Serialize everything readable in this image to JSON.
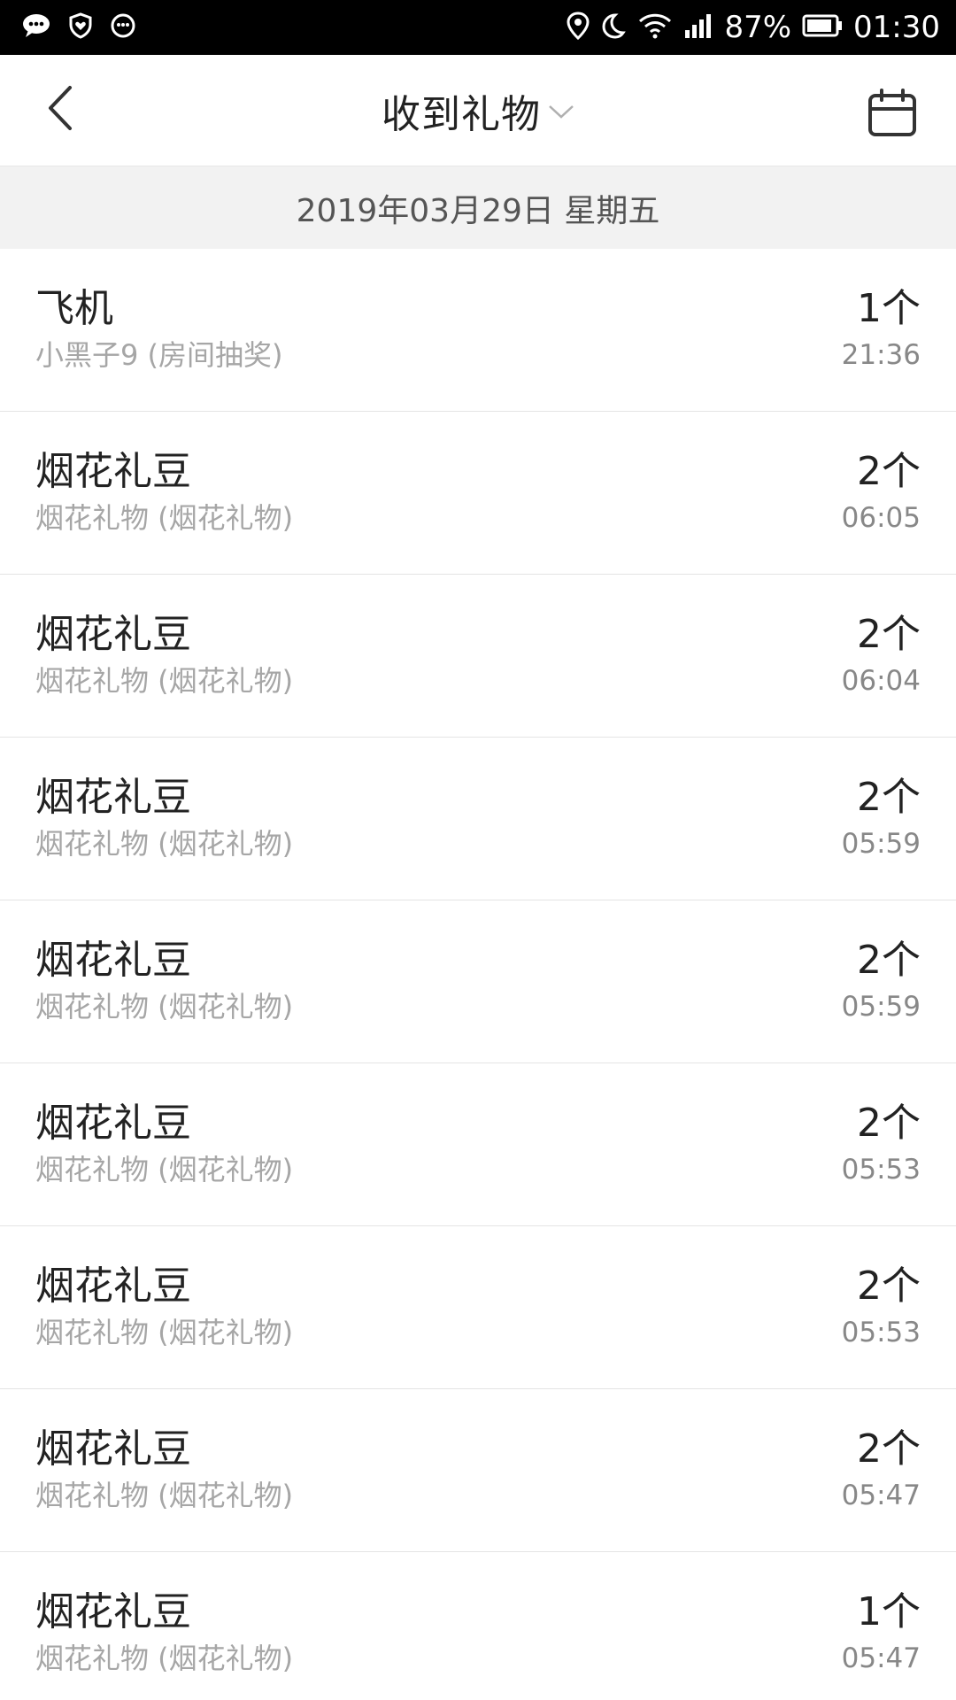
{
  "status_bar": {
    "battery": "87%",
    "time": "01:30"
  },
  "header": {
    "title": "收到礼物"
  },
  "date_bar": {
    "date": "2019年03月29日 星期五"
  },
  "gifts": [
    {
      "name": "飞机",
      "sender": "小黑子9 (房间抽奖)",
      "count": "1个",
      "time": "21:36"
    },
    {
      "name": "烟花礼豆",
      "sender": "烟花礼物 (烟花礼物)",
      "count": "2个",
      "time": "06:05"
    },
    {
      "name": "烟花礼豆",
      "sender": "烟花礼物 (烟花礼物)",
      "count": "2个",
      "time": "06:04"
    },
    {
      "name": "烟花礼豆",
      "sender": "烟花礼物 (烟花礼物)",
      "count": "2个",
      "time": "05:59"
    },
    {
      "name": "烟花礼豆",
      "sender": "烟花礼物 (烟花礼物)",
      "count": "2个",
      "time": "05:59"
    },
    {
      "name": "烟花礼豆",
      "sender": "烟花礼物 (烟花礼物)",
      "count": "2个",
      "time": "05:53"
    },
    {
      "name": "烟花礼豆",
      "sender": "烟花礼物 (烟花礼物)",
      "count": "2个",
      "time": "05:53"
    },
    {
      "name": "烟花礼豆",
      "sender": "烟花礼物 (烟花礼物)",
      "count": "2个",
      "time": "05:47"
    },
    {
      "name": "烟花礼豆",
      "sender": "烟花礼物 (烟花礼物)",
      "count": "1个",
      "time": "05:47"
    }
  ],
  "icons": {
    "status_left": [
      "chat-bubble-icon",
      "heart-shield-icon",
      "smiley-icon"
    ],
    "status_right": [
      "location-pin-icon",
      "moon-icon",
      "wifi-icon",
      "signal-icon",
      "battery-icon"
    ],
    "back": "back-arrow-icon",
    "chevron": "chevron-down-icon",
    "calendar": "calendar-icon"
  }
}
